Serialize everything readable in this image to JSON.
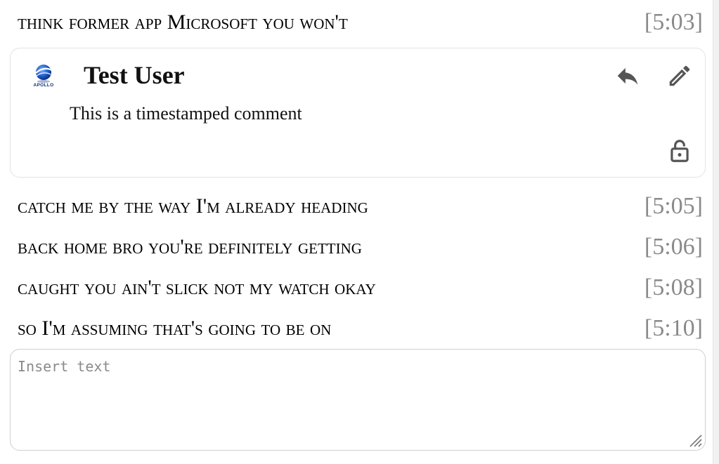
{
  "transcript": {
    "lines": [
      {
        "text": "think former app Microsoft you won't",
        "time": "[5:03]"
      },
      {
        "text": "catch me by the way I'm already heading",
        "time": "[5:05]"
      },
      {
        "text": "back home bro you're definitely getting",
        "time": "[5:06]"
      },
      {
        "text": "caught you ain't slick not my watch okay",
        "time": "[5:08]"
      },
      {
        "text": "so I'm assuming that's going to be on",
        "time": "[5:10]"
      }
    ]
  },
  "comment": {
    "author": "Test User",
    "body": "This is a timestamped comment",
    "avatar_logo_text": "APOLLO",
    "icons": {
      "reply": "reply-icon",
      "edit": "pencil-icon",
      "lock": "unlock-icon"
    },
    "icon_color": "#555555"
  },
  "editor": {
    "placeholder": "Insert text",
    "value": ""
  },
  "colors": {
    "timestamp": "#8a8a8a",
    "card_border": "#e3e3e3"
  }
}
